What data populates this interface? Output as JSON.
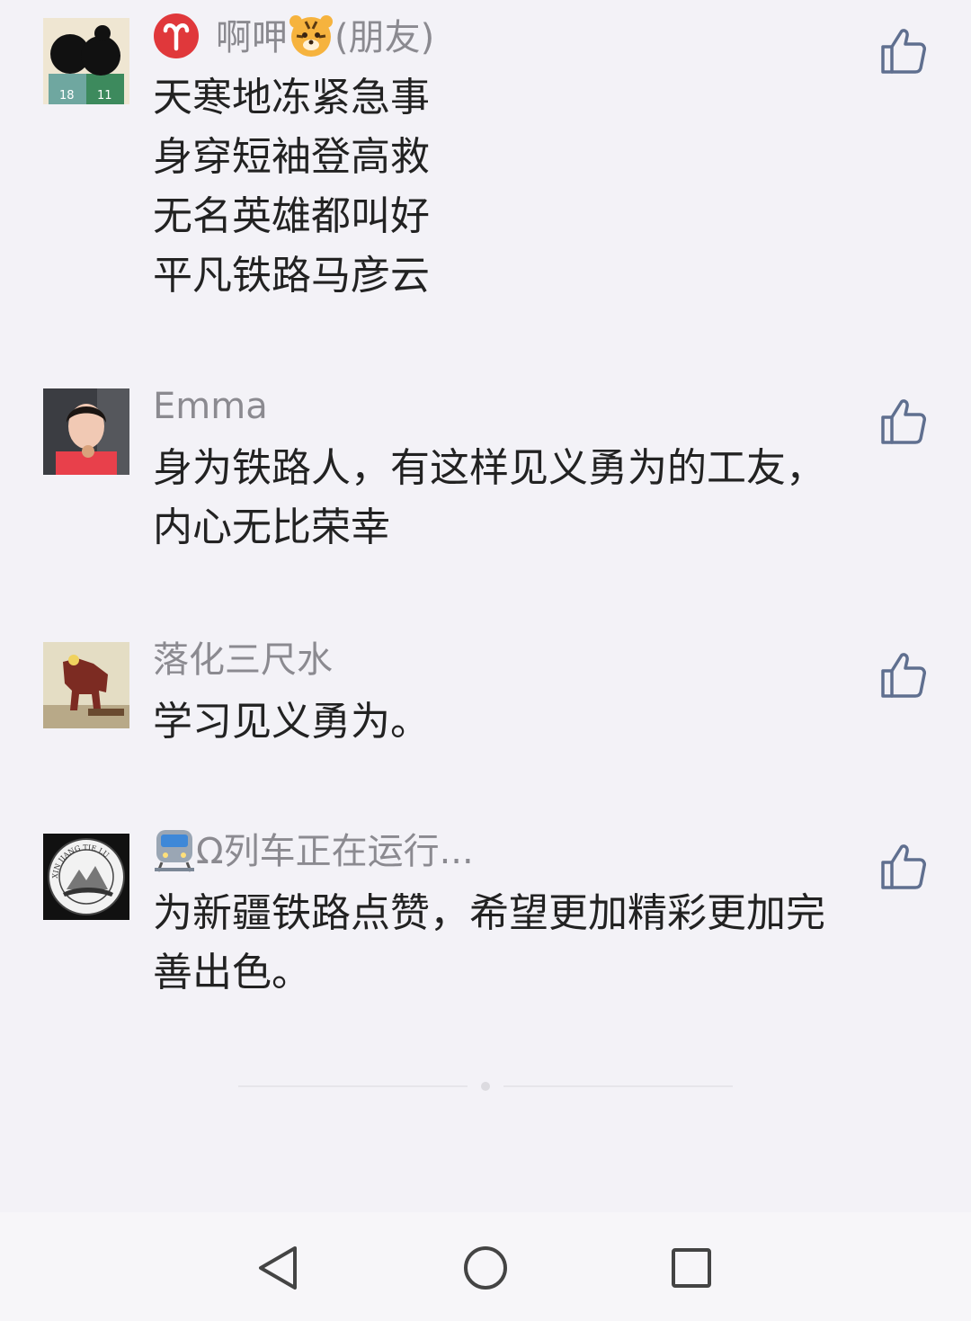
{
  "comments": [
    {
      "name_emoji_left": "aries-icon",
      "name": "啊呷",
      "name_emoji_right": "tiger-face-icon",
      "name_suffix": "(朋友)",
      "lines": [
        "天寒地冻紧急事",
        "身穿短袖登高救",
        "无名英雄都叫好",
        "平凡铁路马彦云"
      ]
    },
    {
      "name": "Emma",
      "lines": [
        "身为铁路人，有这样见义勇为的工友，",
        "内心无比荣幸"
      ]
    },
    {
      "name": "落化三尺水",
      "lines": [
        "学习见义勇为。"
      ]
    },
    {
      "name_emoji_left": "train-icon",
      "name": "Ω列车正在运行...",
      "lines": [
        "为新疆铁路点赞，希望更加精彩更加完",
        "善出色。"
      ],
      "avatar_text": "XIN JIANG TIE LU"
    }
  ],
  "colors": {
    "background": "#f3f2f7",
    "name": "#8b8a90",
    "text": "#222222",
    "icon": "#5f6f8f"
  },
  "nav": {
    "back": "back-triangle-icon",
    "home": "home-circle-icon",
    "recents": "recents-square-icon"
  }
}
